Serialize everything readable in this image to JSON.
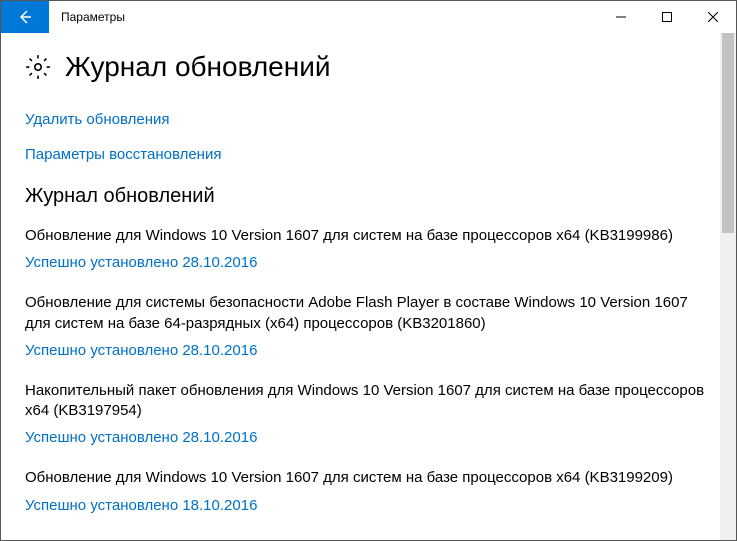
{
  "window": {
    "title": "Параметры"
  },
  "header": {
    "page_title": "Журнал обновлений"
  },
  "links": {
    "uninstall": "Удалить обновления",
    "recovery": "Параметры восстановления"
  },
  "section": {
    "heading": "Журнал обновлений"
  },
  "updates": [
    {
      "title": "Обновление для Windows 10 Version 1607 для систем на базе процессоров x64 (KB3199986)",
      "status": "Успешно установлено 28.10.2016"
    },
    {
      "title": "Обновление для системы безопасности Adobe Flash Player в составе Windows 10 Version 1607 для систем на базе 64-разрядных (x64) процессоров (KB3201860)",
      "status": "Успешно установлено 28.10.2016"
    },
    {
      "title": "Накопительный пакет обновления для Windows 10 Version 1607 для систем на базе процессоров x64 (KB3197954)",
      "status": "Успешно установлено 28.10.2016"
    },
    {
      "title": "Обновление для Windows 10 Version 1607 для систем на базе процессоров x64 (KB3199209)",
      "status": "Успешно установлено 18.10.2016"
    }
  ]
}
